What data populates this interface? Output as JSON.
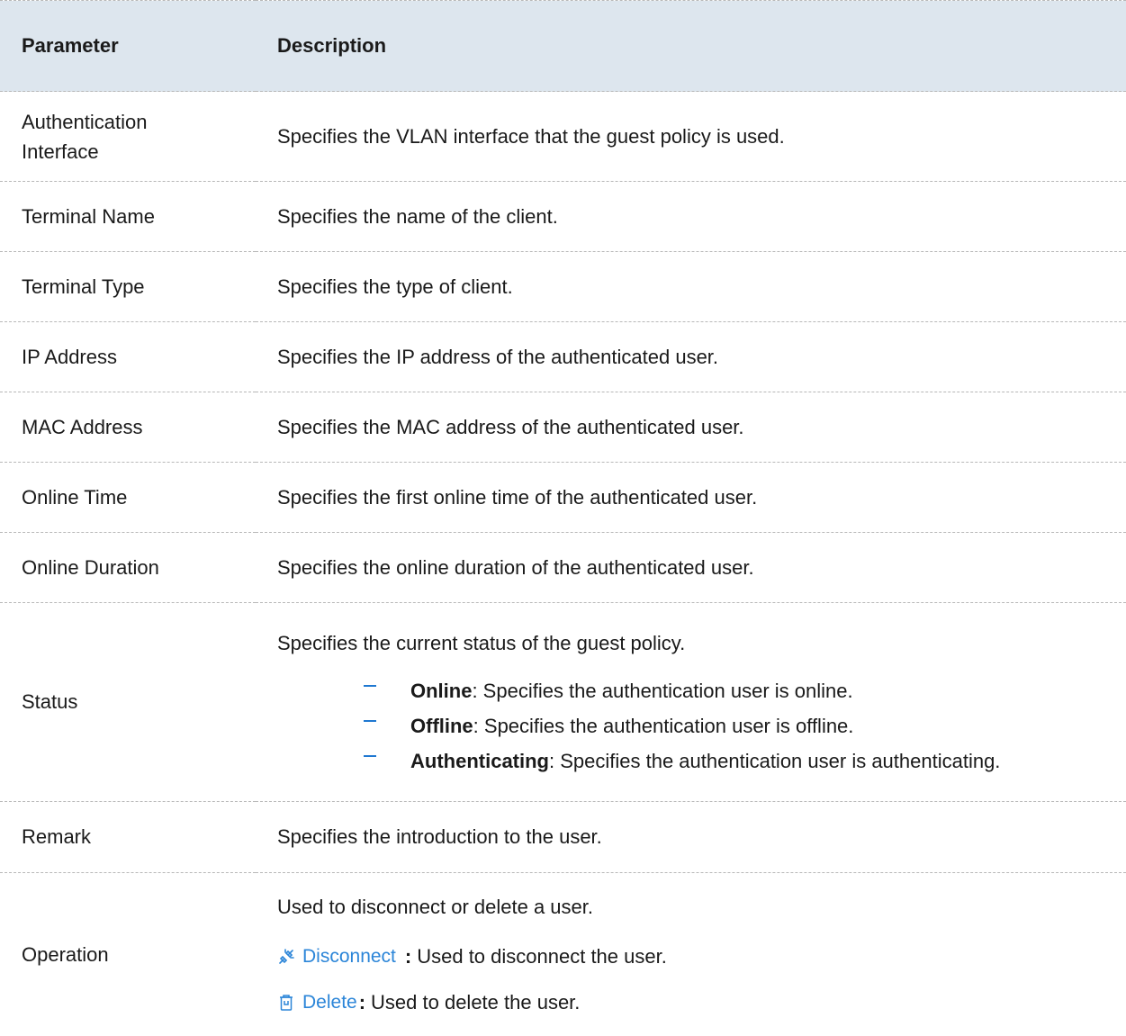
{
  "table": {
    "headers": {
      "parameter": "Parameter",
      "description": "Description"
    },
    "rows": [
      {
        "parameter": "Authentication Interface",
        "description": "Specifies the VLAN interface that the guest policy is used."
      },
      {
        "parameter": "Terminal Name",
        "description": "Specifies the name of the client."
      },
      {
        "parameter": "Terminal Type",
        "description": "Specifies the type of client."
      },
      {
        "parameter": "IP Address",
        "description": "Specifies the IP address of the authenticated user."
      },
      {
        "parameter": "MAC Address",
        "description": "Specifies the MAC address of the authenticated user."
      },
      {
        "parameter": "Online Time",
        "description": "Specifies the first online time of the authenticated user."
      },
      {
        "parameter": "Online Duration",
        "description": "Specifies the online duration of the authenticated user."
      },
      {
        "parameter": "Status",
        "description": "Specifies the current status of the guest policy.",
        "bullets": [
          {
            "term": "Online",
            "text": ": Specifies the authentication user is online."
          },
          {
            "term": "Offline",
            "text": ": Specifies the authentication user is offline."
          },
          {
            "term": "Authenticating",
            "text": ": Specifies the authentication user is authenticating."
          }
        ]
      },
      {
        "parameter": "Remark",
        "description": "Specifies the introduction to the user."
      },
      {
        "parameter": "Operation",
        "description": "Used to disconnect or delete a user.",
        "actions": [
          {
            "button": "Disconnect",
            "icon": "disconnect-icon",
            "colon": ":",
            "text": "Used to disconnect the user."
          },
          {
            "button": "Delete",
            "icon": "trash-icon",
            "colon": ":",
            "text": "Used to delete the user."
          }
        ]
      }
    ]
  },
  "colors": {
    "header_bg": "#dde6ee",
    "link_blue": "#2b85d8",
    "bullet_dash": "#1f78d1",
    "row_border": "#b8b8b8"
  }
}
